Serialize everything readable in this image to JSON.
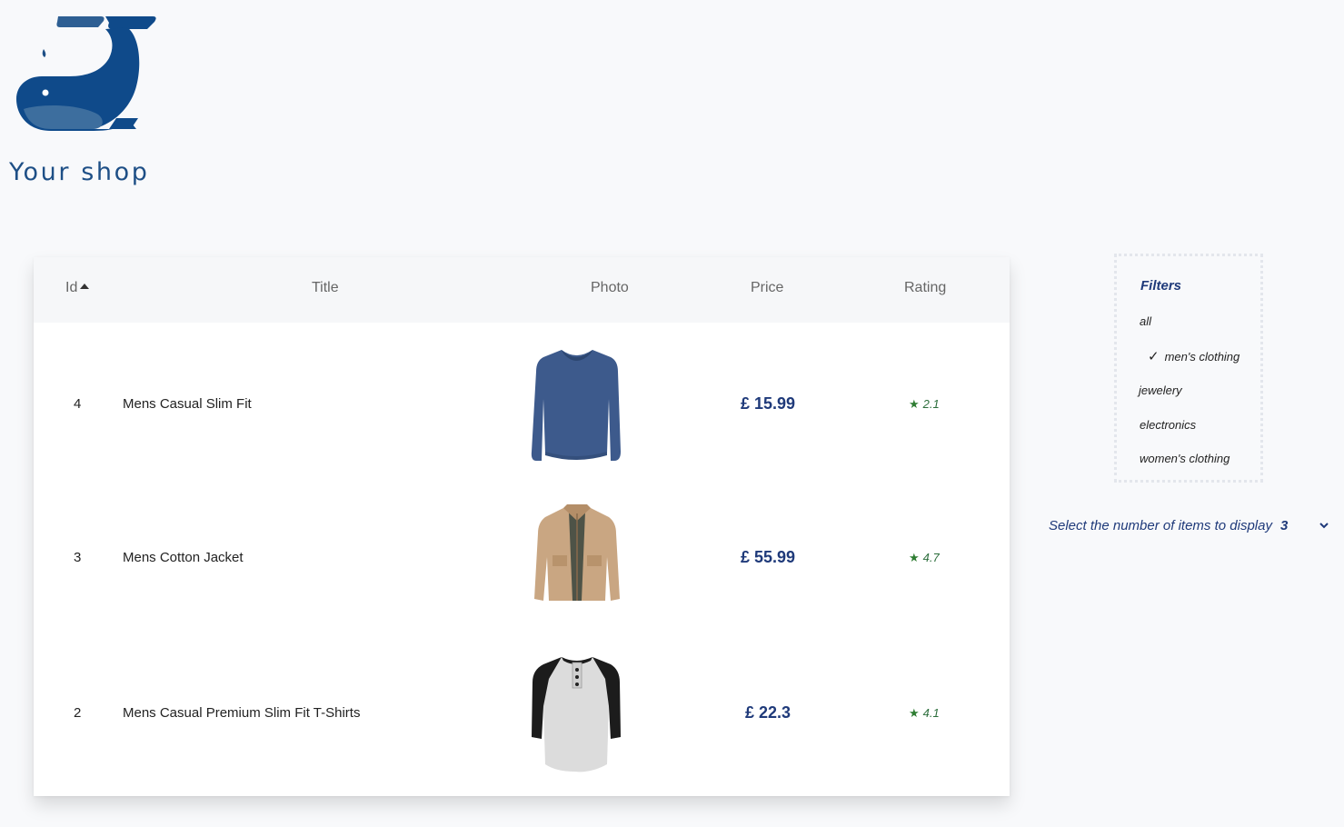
{
  "brand": {
    "name": "Your shop",
    "logo_icon": "whale-logo-icon",
    "color": "#1e4f86"
  },
  "table": {
    "headers": {
      "id": "Id",
      "title": "Title",
      "photo": "Photo",
      "price": "Price",
      "rating": "Rating"
    },
    "sort": {
      "column": "id",
      "direction": "ascending",
      "icon": "sort-up-icon"
    },
    "rows": [
      {
        "id": "4",
        "title": "Mens Casual Slim Fit",
        "photo": "blue-long-sleeve-shirt",
        "price": "£ 15.99",
        "rating": "2.1"
      },
      {
        "id": "3",
        "title": "Mens Cotton Jacket",
        "photo": "beige-cotton-jacket",
        "price": "£ 55.99",
        "rating": "4.7"
      },
      {
        "id": "2",
        "title": "Mens Casual Premium Slim Fit T-Shirts",
        "photo": "raglan-henley-tshirt",
        "price": "£ 22.3",
        "rating": "4.1"
      }
    ]
  },
  "filters": {
    "title": "Filters",
    "items": [
      {
        "label": "all",
        "selected": false
      },
      {
        "label": "men's clothing",
        "selected": true
      },
      {
        "label": "jewelery",
        "selected": false
      },
      {
        "label": "electronics",
        "selected": false
      },
      {
        "label": "women's clothing",
        "selected": false
      }
    ]
  },
  "items_select": {
    "label": "Select the number of items to display",
    "value": "3",
    "icon": "chevron-down-icon"
  },
  "colors": {
    "price": "#1f3a7a",
    "rating": "#2e7d32",
    "accent": "#1e4f86"
  }
}
